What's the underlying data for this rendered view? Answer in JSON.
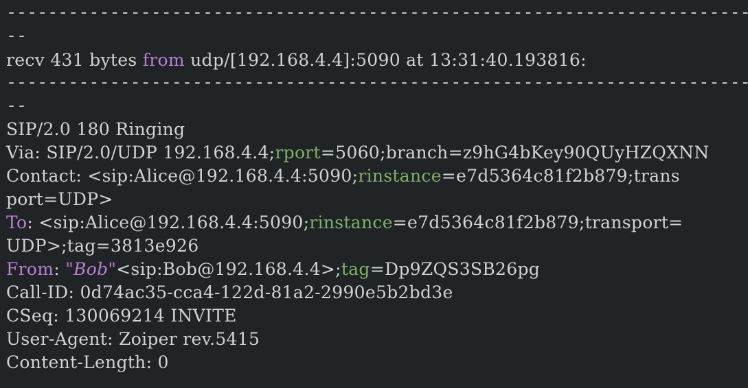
{
  "colors": {
    "background": "#212426",
    "text": "#d2d2d2",
    "keyword": "#b77fd0",
    "parameter": "#7fb069"
  },
  "terminal": {
    "separator_a": "------------------------------------------------------------------------",
    "separator_b": "--",
    "recv_prefix": "recv 431 bytes ",
    "recv_from": "from",
    "recv_suffix": " udp/[192.168.4.4]:5090 at 13:31:40.193816:",
    "status_line": "SIP/2.0 180 Ringing",
    "via_prefix": "Via: SIP/2.0/UDP 192.168.4.4;",
    "via_rport": "rport",
    "via_suffix": "=5060;branch=z9hG4bKey90QUyHZQXNN",
    "contact_prefix": "Contact: <sip:Alice@192.168.4.4:5090;",
    "contact_rinstance": "rinstance",
    "contact_suffix": "=e7d5364c81f2b879;trans",
    "contact_cont": "port=UDP>",
    "to_key": "To",
    "to_prefix": ": <sip:Alice@192.168.4.4:5090;",
    "to_rinstance": "rinstance",
    "to_suffix": "=e7d5364c81f2b879;transport=",
    "to_cont": "UDP>;tag=3813e926",
    "from_key": "From",
    "from_colon": ": ",
    "from_name": "\"Bob\"",
    "from_uri": "<sip:Bob@192.168.4.4>;",
    "from_tag": "tag",
    "from_tag_value": "=Dp9ZQS3SB26pg",
    "call_id": "Call-ID: 0d74ac35-cca4-122d-81a2-2990e5b2bd3e",
    "cseq": "CSeq: 130069214 INVITE",
    "user_agent": "User-Agent: Zoiper rev.5415",
    "content_length": "Content-Length: 0"
  }
}
